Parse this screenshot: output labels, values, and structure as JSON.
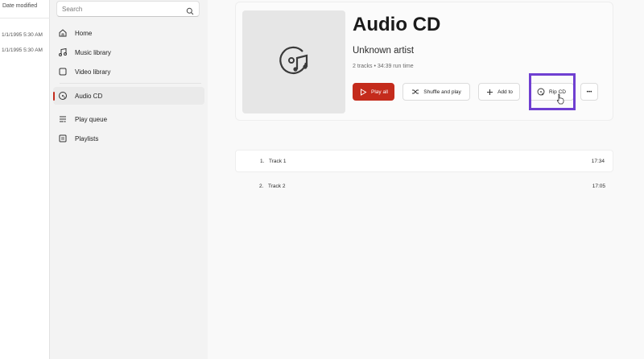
{
  "explorer": {
    "column_header": "Date modified",
    "rows": [
      "1/1/1995 5:30 AM",
      "1/1/1995 5:30 AM"
    ]
  },
  "sidebar": {
    "search": {
      "placeholder": "Search",
      "value": ""
    },
    "items": [
      {
        "label": "Home",
        "icon": "home-icon"
      },
      {
        "label": "Music library",
        "icon": "music-note-icon"
      },
      {
        "label": "Video library",
        "icon": "video-icon"
      },
      {
        "label": "Audio CD",
        "icon": "cd-icon",
        "active": true
      },
      {
        "label": "Play queue",
        "icon": "queue-icon"
      },
      {
        "label": "Playlists",
        "icon": "playlist-icon"
      }
    ]
  },
  "album": {
    "title": "Audio CD",
    "artist": "Unknown artist",
    "meta": "2 tracks • 34:39 run time",
    "art_icon": "cd-music-icon"
  },
  "actions": {
    "play_all": "Play all",
    "shuffle": "Shuffle and play",
    "add_to": "Add to",
    "rip_cd": "Rip CD",
    "more": "•••"
  },
  "tracks": [
    {
      "number": "1.",
      "title": "Track 1",
      "duration": "17:34"
    },
    {
      "number": "2.",
      "title": "Track 2",
      "duration": "17:05"
    }
  ],
  "colors": {
    "accent": "#c42b1c",
    "highlight": "#6f3fd1"
  }
}
